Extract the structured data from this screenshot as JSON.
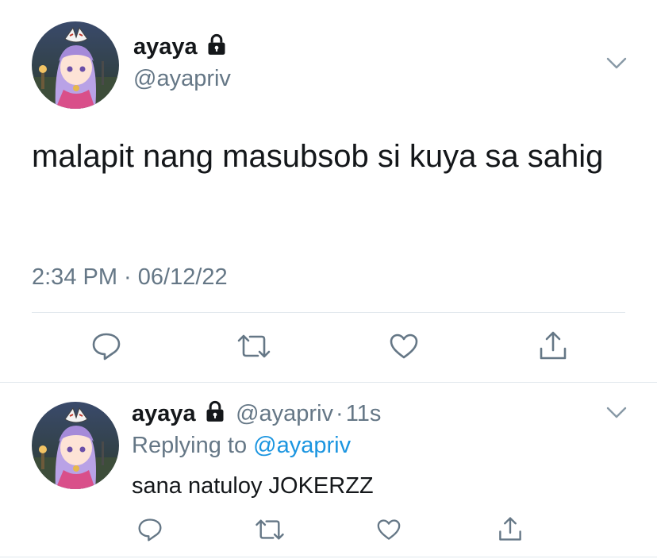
{
  "main_tweet": {
    "display_name": "ayaya",
    "handle": "@ayapriv",
    "text": "malapit nang masubsob si kuya sa sahig",
    "timestamp": "2:34 PM · 06/12/22",
    "icons": [
      "lock-icon",
      "chevron-down-icon",
      "reply-icon",
      "retweet-icon",
      "like-icon",
      "share-icon"
    ]
  },
  "reply_tweet": {
    "display_name": "ayaya",
    "handle": "@ayapriv",
    "separator": "·",
    "time": "11s",
    "replying_prefix": "Replying to",
    "replying_to": "@ayapriv",
    "text": "sana natuloy JOKERZZ"
  },
  "colors": {
    "text": "#14171a",
    "secondary": "#657786",
    "link": "#1b95e0",
    "divider": "#e1e8ed"
  }
}
